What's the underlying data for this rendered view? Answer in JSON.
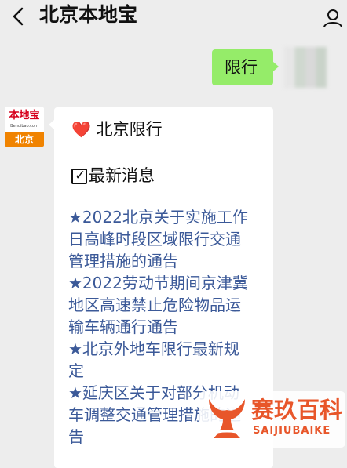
{
  "header": {
    "title": "北京本地宝"
  },
  "my_message": {
    "text": "限行"
  },
  "account_avatar": {
    "brand": "本地宝",
    "url": "Bendibao.com",
    "city": "北京"
  },
  "reply": {
    "heart_emoji": "❤️",
    "line1": "北京限行",
    "check_mark": "✓",
    "line2": "最新消息",
    "link_lines": [
      "★2022北京关于实施工作",
      "日高峰时段区域限行交通",
      "管理措施的通告",
      "★2022劳动节期间京津冀",
      "地区高速禁止危险物品运",
      "输车辆通行通告",
      "★北京外地车限行最新规",
      "定",
      "★延庆区关于对部分机动",
      "车调整交通管理措施的通",
      "告"
    ]
  },
  "watermark": {
    "title": "赛玖百科",
    "subtitle": "SAIJIUBAIKE"
  },
  "colors": {
    "background": "#ededed",
    "my_bubble": "#95ec69",
    "link": "#3b5998",
    "watermark": "#e8562a"
  }
}
